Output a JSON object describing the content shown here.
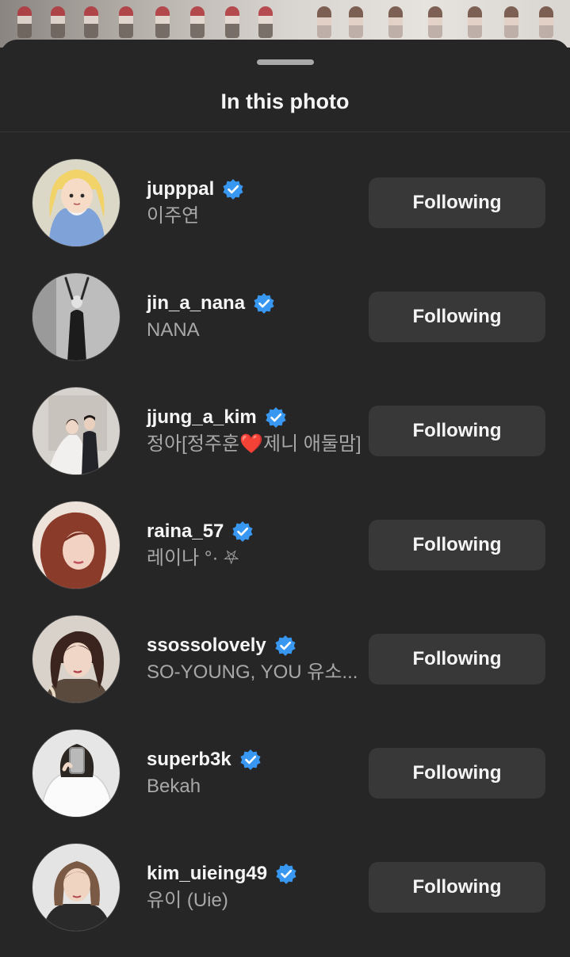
{
  "sheet": {
    "title": "In this photo"
  },
  "colors": {
    "background": "#262626",
    "button": "#383838",
    "verified_badge": "#3897f0",
    "secondary_text": "#a8a8a8"
  },
  "people": [
    {
      "username": "jupppal",
      "full_name": "이주연",
      "verified": true,
      "button_label": "Following"
    },
    {
      "username": "jin_a_nana",
      "full_name": "NANA",
      "verified": true,
      "button_label": "Following"
    },
    {
      "username": "jjung_a_kim",
      "full_name": "정아[정주훈❤️제니 애둘맘]",
      "verified": true,
      "button_label": "Following"
    },
    {
      "username": "raina_57",
      "full_name": "레이나 °· ⛧",
      "verified": true,
      "button_label": "Following"
    },
    {
      "username": "ssossolovely",
      "full_name": "SO-YOUNG, YOU   유소...",
      "verified": true,
      "button_label": "Following"
    },
    {
      "username": "superb3k",
      "full_name": "Bekah",
      "verified": true,
      "button_label": "Following"
    },
    {
      "username": "kim_uieing49",
      "full_name": "유이 (Uie)",
      "verified": true,
      "button_label": "Following"
    }
  ]
}
